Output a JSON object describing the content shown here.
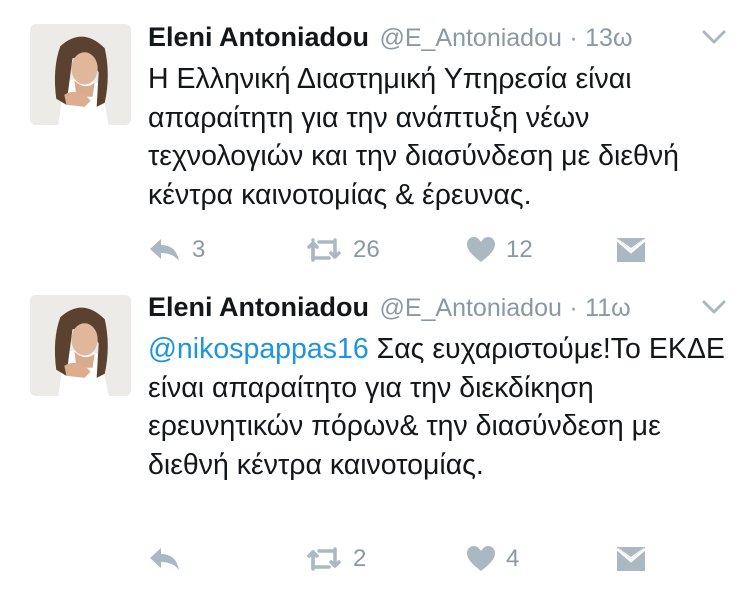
{
  "colors": {
    "text": "#14171a",
    "secondary": "#8899a6",
    "link": "#1b95e0",
    "icon": "#aab8c2"
  },
  "tweets": [
    {
      "name": "Eleni Antoniadou",
      "handle": "@E_Antoniadou",
      "dot": "·",
      "time": "13ω",
      "text": "Η Ελληνική Διαστημική Υπηρεσία είναι απαραίτητη για την ανάπτυξη νέων τεχνολογιών και την διασύνδεση με διεθνή κέντρα καινοτομίας & έρευνας.",
      "replies": "3",
      "retweets": "26",
      "likes": "12"
    },
    {
      "name": "Eleni Antoniadou",
      "handle": "@E_Antoniadou",
      "dot": "·",
      "time": "11ω",
      "mention": "@nikospappas16",
      "text": " Σας ευχαριστούμε!Το ΕΚΔΕ είναι απαραίτητο για την διεκδίκηση ερευνητικών πόρων& την διασύνδεση με διεθνή κέντρα καινοτομίας.",
      "replies": "",
      "retweets": "2",
      "likes": "4"
    }
  ]
}
